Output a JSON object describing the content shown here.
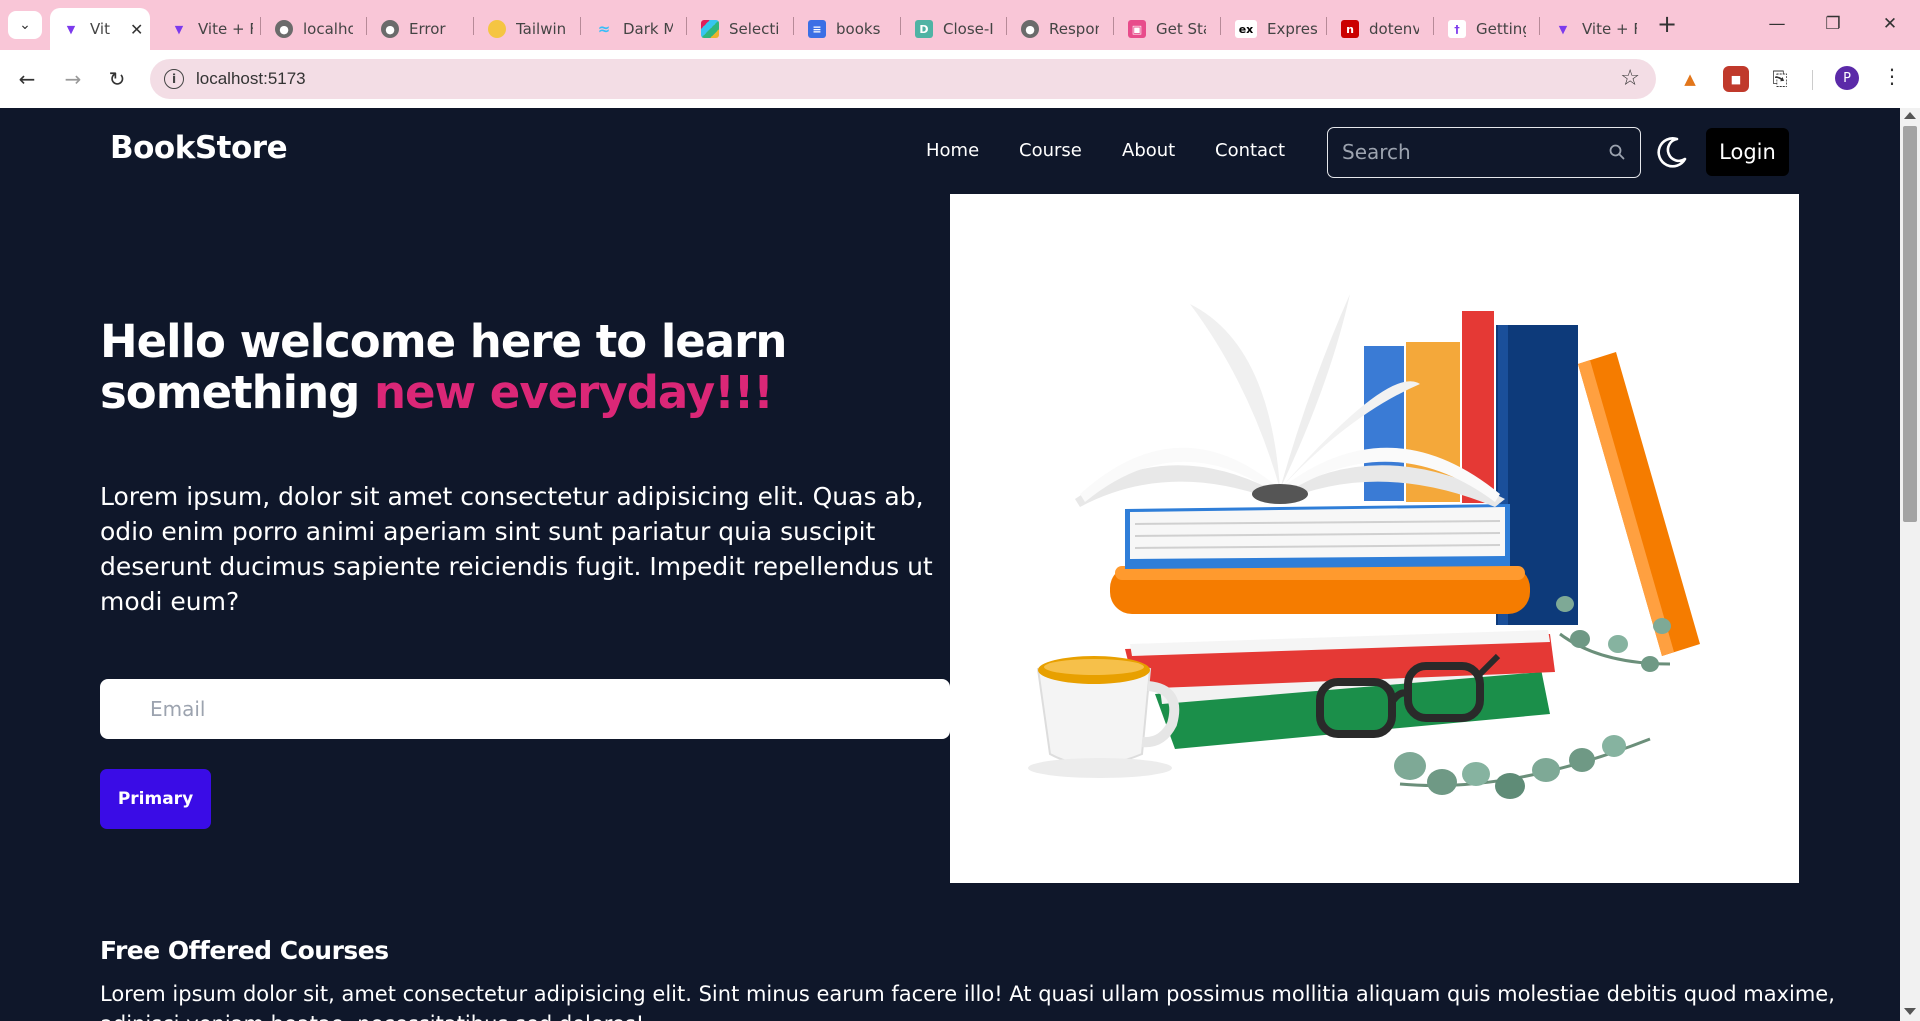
{
  "browser": {
    "tabs": [
      {
        "title": "Vit",
        "icon": "vite-icon",
        "active": true
      },
      {
        "title": "Vite + F",
        "icon": "vite-icon"
      },
      {
        "title": "localho",
        "icon": "globe-icon"
      },
      {
        "title": "Error",
        "icon": "globe-icon"
      },
      {
        "title": "Tailwin",
        "icon": "tailwind-mascot-icon"
      },
      {
        "title": "Dark M",
        "icon": "tailwind-icon"
      },
      {
        "title": "Selectio",
        "icon": "slack-icon"
      },
      {
        "title": "books",
        "icon": "forms-icon"
      },
      {
        "title": "Close-I",
        "icon": "close-i-icon"
      },
      {
        "title": "Respon",
        "icon": "globe-icon"
      },
      {
        "title": "Get Sta",
        "icon": "get-started-icon"
      },
      {
        "title": "Express",
        "icon": "express-icon"
      },
      {
        "title": "dotenv",
        "icon": "npm-icon"
      },
      {
        "title": "Getting",
        "icon": "getting-started-icon"
      },
      {
        "title": "Vite + F",
        "icon": "vite-icon"
      }
    ],
    "url": "localhost:5173",
    "profile_initial": "P",
    "chrome_color": "#f9c6d7"
  },
  "nav": {
    "brand": "BookStore",
    "links": [
      "Home",
      "Course",
      "About",
      "Contact"
    ],
    "search_placeholder": "Search",
    "login_label": "Login"
  },
  "hero": {
    "title_line1": "Hello welcome here to learn",
    "title_line2_start": "something",
    "title_accent": "new everyday!!!",
    "text": "Lorem ipsum, dolor sit amet consectetur adipisicing elit. Quas ab, odio enim porro animi aperiam sint sunt pariatur quia suscipit deserunt ducimus sapiente reiciendis fugit. Impedit repellendus ut modi eum?",
    "email_placeholder": "Email",
    "button_label": "Primary",
    "accent_color": "#db2777",
    "button_color": "#3a0ce6"
  },
  "section": {
    "title": "Free Offered Courses",
    "text": "Lorem ipsum dolor sit, amet consectetur adipisicing elit. Sint minus earum facere illo! At quasi ullam possimus mollitia aliquam quis molestiae debitis quod maxime, adipisci veniam beatae, necessitatibus sed dolores!"
  },
  "colors": {
    "page_bg": "#0f172a"
  }
}
